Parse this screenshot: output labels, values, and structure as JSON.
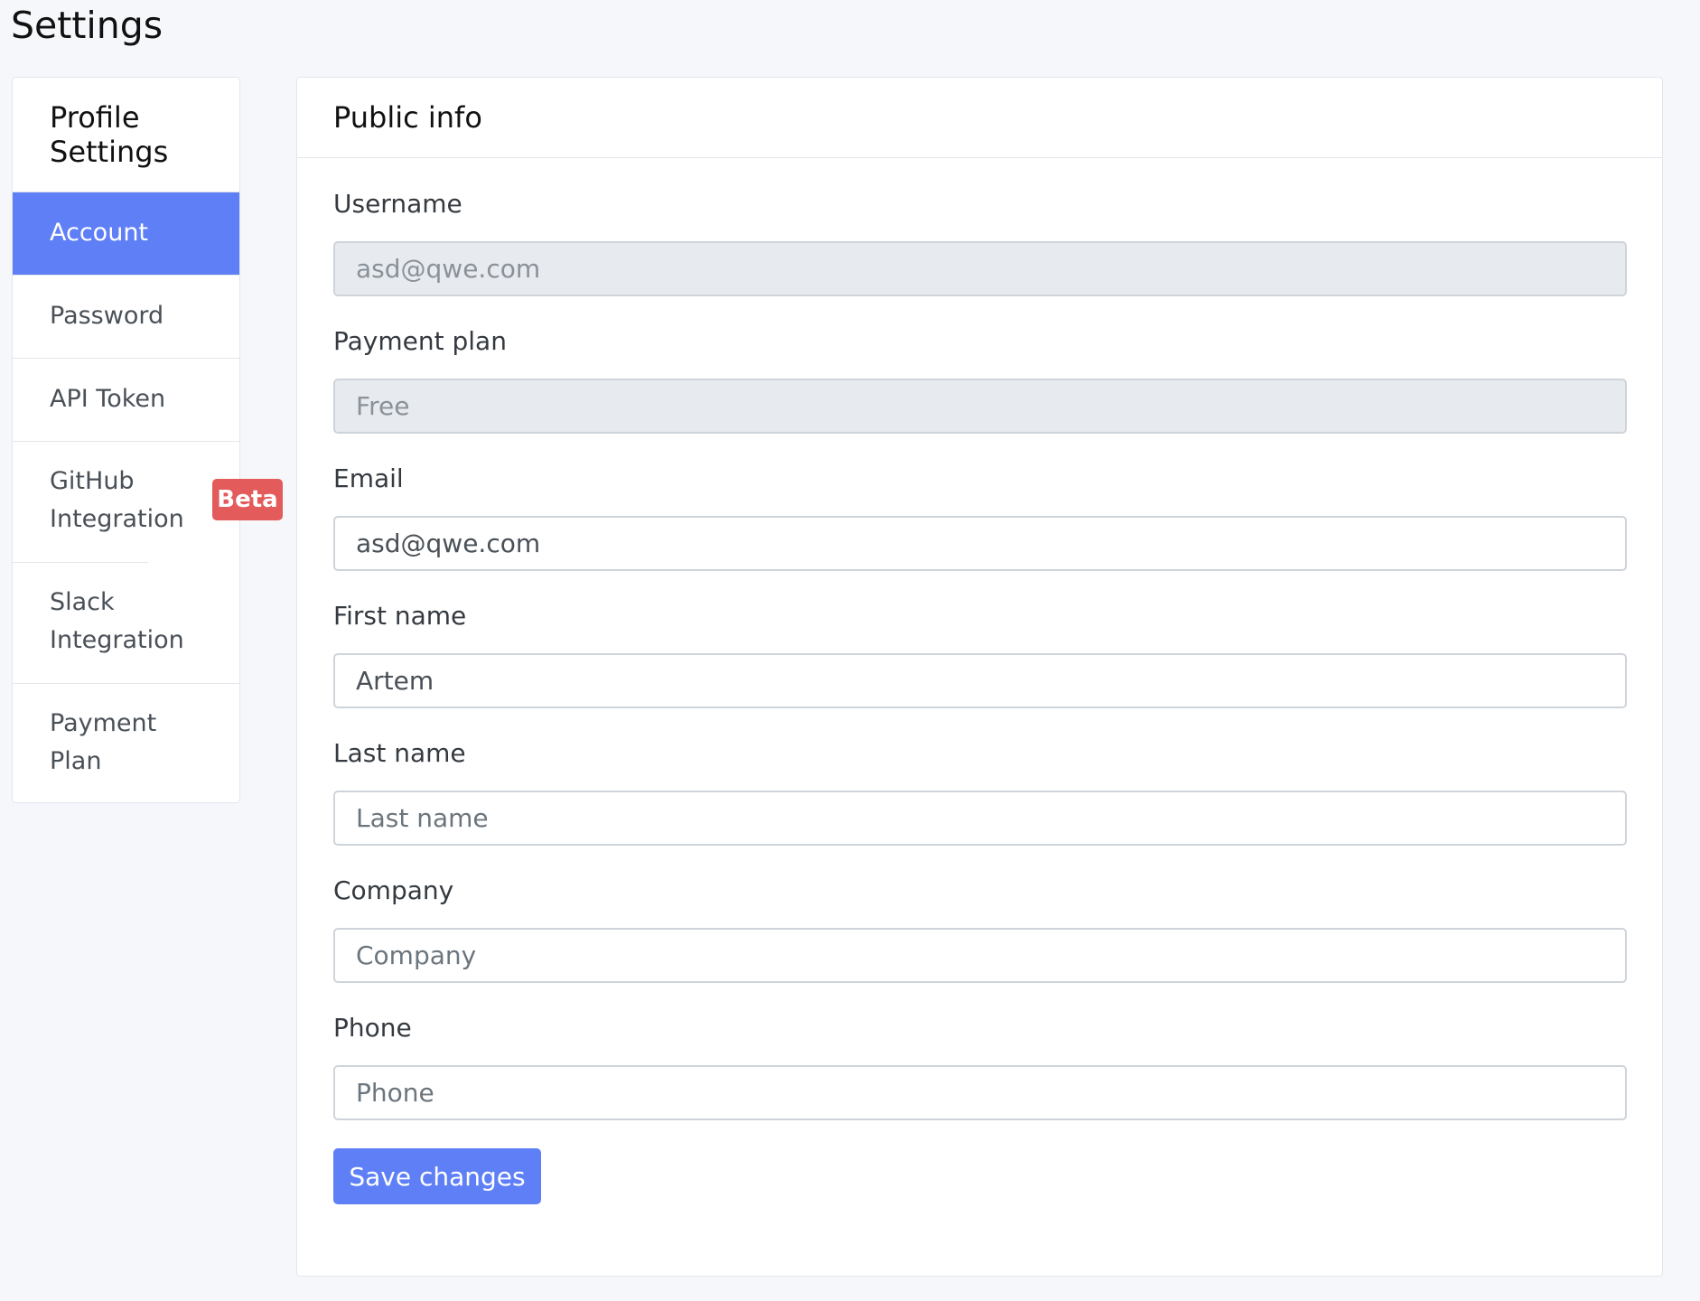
{
  "page": {
    "title": "Settings"
  },
  "sidebar": {
    "header": "Profile Settings",
    "items": [
      {
        "label": "Account",
        "active": true
      },
      {
        "label": "Password"
      },
      {
        "label": "API Token"
      },
      {
        "label": "GitHub Integration",
        "badge": "Beta"
      },
      {
        "label": "Slack Integration"
      },
      {
        "label": "Payment Plan"
      }
    ]
  },
  "card": {
    "title": "Public info"
  },
  "form": {
    "username": {
      "label": "Username",
      "value": "asd@qwe.com"
    },
    "payment_plan": {
      "label": "Payment plan",
      "value": "Free"
    },
    "email": {
      "label": "Email",
      "value": "asd@qwe.com"
    },
    "first_name": {
      "label": "First name",
      "value": "Artem"
    },
    "last_name": {
      "label": "Last name",
      "placeholder": "Last name"
    },
    "company": {
      "label": "Company",
      "placeholder": "Company"
    },
    "phone": {
      "label": "Phone",
      "placeholder": "Phone"
    },
    "save_label": "Save changes"
  },
  "colors": {
    "accent": "#5f7ff7",
    "badge": "#e35b5b",
    "background": "#f5f7fb",
    "readonly_bg": "#e7eaee"
  }
}
